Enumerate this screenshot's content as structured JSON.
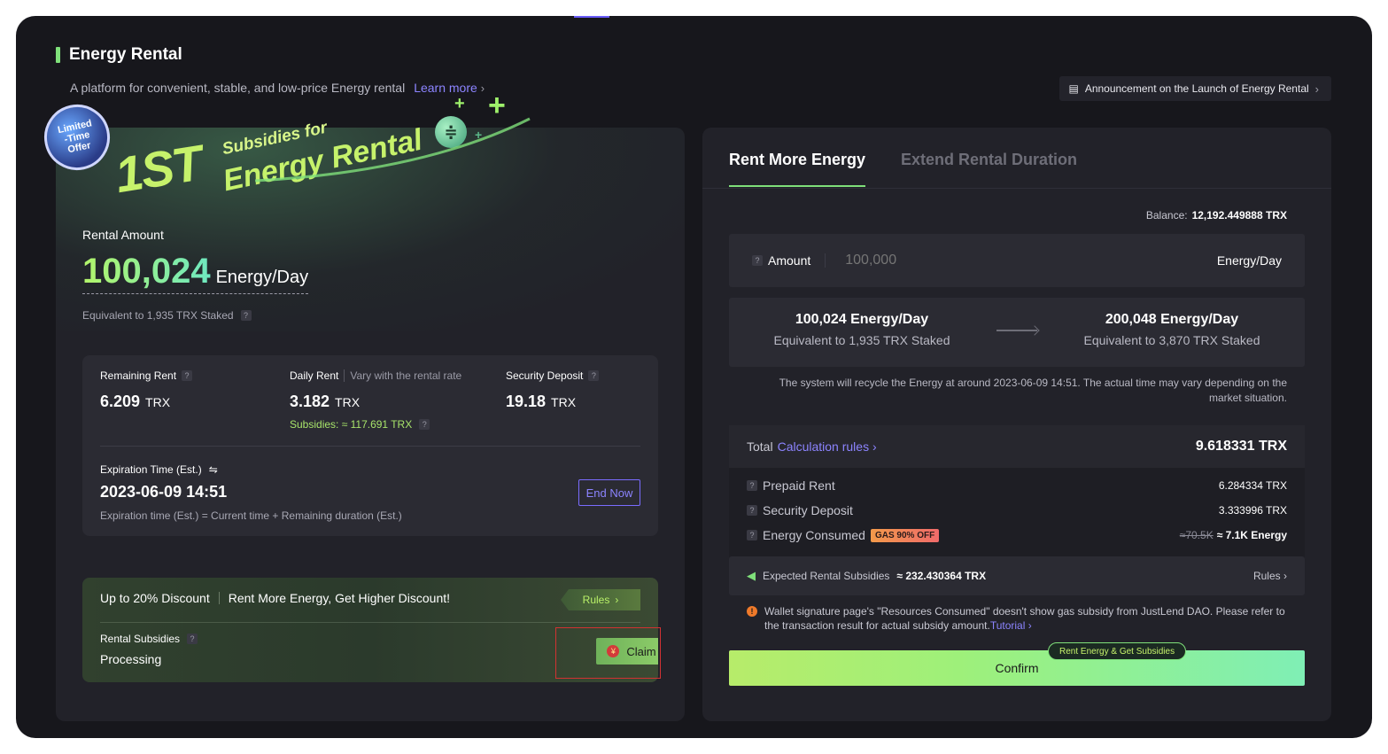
{
  "header": {
    "title": "Energy Rental",
    "subtitle": "A platform for convenient, stable, and low-price Energy rental",
    "learn_more": "Learn more",
    "announcement": "Announcement on the Launch of Energy Rental"
  },
  "banner": {
    "badge_line1": "Limited",
    "badge_line2": "-Time",
    "badge_line3": "Offer",
    "big_text": "1ST",
    "sub_text": "Subsidies for",
    "main_text": "Energy Rental"
  },
  "rental": {
    "label": "Rental Amount",
    "amount": "100,024",
    "unit": "Energy/Day",
    "equivalent": "Equivalent to 1,935 TRX Staked"
  },
  "stats": {
    "remaining_rent_label": "Remaining Rent",
    "remaining_rent_value": "6.209",
    "daily_rent_label": "Daily Rent",
    "daily_rent_note": "Vary with the rental rate",
    "daily_rent_value": "3.182",
    "subsidies": "Subsidies: ≈ 117.691 TRX",
    "security_deposit_label": "Security Deposit",
    "security_deposit_value": "19.18",
    "currency": "TRX",
    "expiration_label": "Expiration Time (Est.)",
    "expiration_value": "2023-06-09 14:51",
    "expiration_note": "Expiration time (Est.) = Current time + Remaining duration (Est.)",
    "end_now": "End Now"
  },
  "discount": {
    "title": "Up to 20% Discount",
    "tagline": "Rent More Energy, Get Higher Discount!",
    "rules": "Rules",
    "subsidies_label": "Rental Subsidies",
    "subsidies_status": "Processing",
    "claim": "Claim"
  },
  "right": {
    "tab_active": "Rent More Energy",
    "tab_inactive": "Extend Rental Duration",
    "balance_label": "Balance:",
    "balance_value": "12,192.449888 TRX",
    "amount_label": "Amount",
    "amount_placeholder": "100,000",
    "amount_unit": "Energy/Day",
    "current_energy": "100,024 Energy/Day",
    "current_equiv": "Equivalent to 1,935 TRX Staked",
    "new_energy": "200,048 Energy/Day",
    "new_equiv": "Equivalent to 3,870 TRX Staked",
    "recycle_note": "The system will recycle the Energy at around 2023-06-09 14:51. The actual time may vary depending on the market situation.",
    "total_label": "Total",
    "calc_rules": "Calculation rules",
    "total_value": "9.618331 TRX",
    "prepaid_label": "Prepaid Rent",
    "prepaid_value": "6.284334 TRX",
    "deposit_label": "Security Deposit",
    "deposit_value": "3.333996 TRX",
    "energy_label": "Energy Consumed",
    "gas_badge": "GAS 90% OFF",
    "energy_old": "≈70.5K",
    "energy_value": "≈ 7.1K Energy",
    "subsidy_label": "Expected Rental Subsidies",
    "subsidy_value": "≈ 232.430364 TRX",
    "subsidy_rules": "Rules",
    "warning": "Wallet signature page's \"Resources Consumed\" doesn't show gas subsidy from JustLend DAO. Please refer to the transaction result for actual subsidy amount.",
    "tutorial": "Tutorial",
    "rent_tag": "Rent Energy & Get Subsidies",
    "confirm": "Confirm"
  },
  "colors": {
    "accent_green": "#7fe07a",
    "accent_purple": "#8c84ff",
    "panel_bg": "#222229",
    "page_bg": "#17171c"
  }
}
